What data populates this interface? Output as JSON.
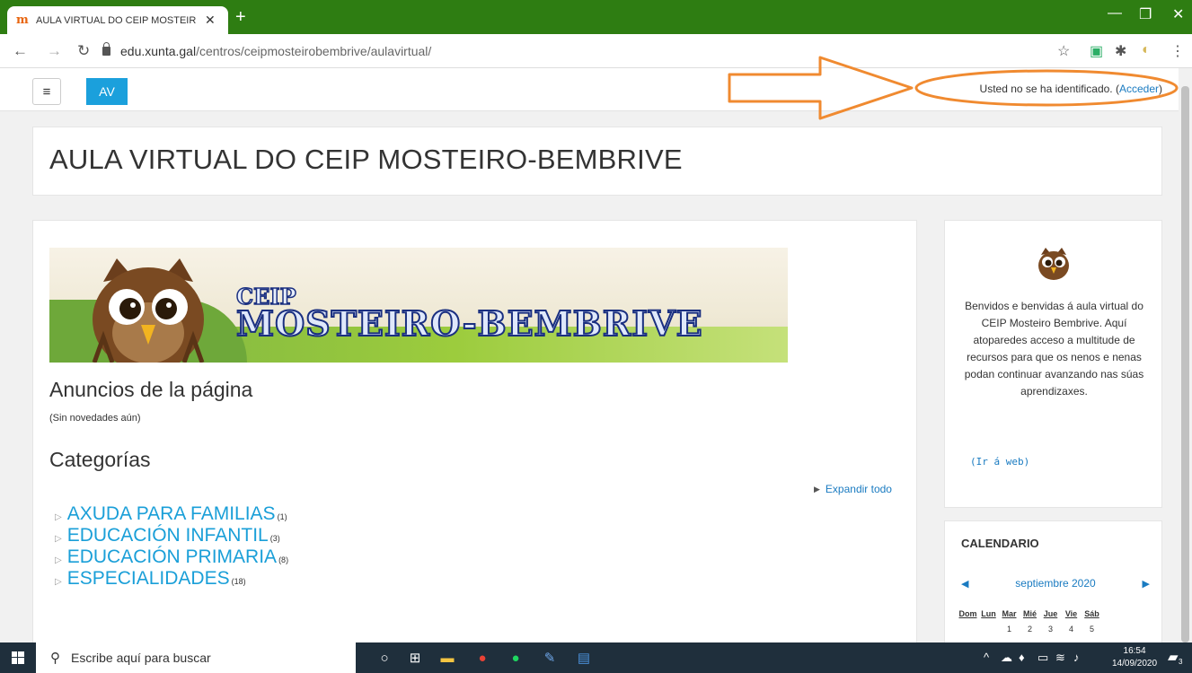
{
  "browser": {
    "tab_title": "AULA VIRTUAL DO CEIP MOSTEIR",
    "url_host": "edu.xunta.gal",
    "url_path": "/centros/ceipmosteirobembrive/aulavirtual/"
  },
  "navbar": {
    "brand": "AV",
    "login_text": "Usted no se ha identificado. (",
    "login_link": "Acceder",
    "login_close": ")"
  },
  "page": {
    "title": "AULA VIRTUAL DO CEIP MOSTEIRO-BEMBRIVE",
    "banner_line1": "CEIP",
    "banner_line2": "MOSTEIRO-BEMBRIVE",
    "anuncios_heading": "Anuncios de la página",
    "sin_novedades": "(Sin novedades aún)",
    "categorias_heading": "Categorías",
    "expandir": "Expandir todo",
    "categories": [
      {
        "name": "AXUDA PARA FAMILIAS",
        "count": "(1)"
      },
      {
        "name": "EDUCACIÓN INFANTIL",
        "count": "(3)"
      },
      {
        "name": "EDUCACIÓN PRIMARIA",
        "count": "(8)"
      },
      {
        "name": "ESPECIALIDADES",
        "count": "(18)"
      }
    ]
  },
  "sidebar": {
    "intro": "Benvidos e benvidas á aula virtual do CEIP Mosteiro Bembrive. Aquí atoparedes acceso a multitude de recursos para que os nenos e nenas podan continuar avanzando nas súas aprendizaxes.",
    "ir_web": "(Ir á web)",
    "calendar": {
      "title": "CALENDARIO",
      "month": "septiembre 2020",
      "days": [
        "Dom",
        "Lun",
        "Mar",
        "Mié",
        "Jue",
        "Vie",
        "Sáb"
      ],
      "first_row": [
        "",
        "",
        "1",
        "2",
        "3",
        "4",
        "5"
      ]
    }
  },
  "taskbar": {
    "search_placeholder": "Escribe aquí para buscar",
    "time": "16:54",
    "date": "14/09/2020",
    "notifications": "3"
  },
  "colors": {
    "browser_frame": "#2e7d12",
    "link": "#1a7bc1",
    "category": "#1a9fd8",
    "brand": "#1ba0dc",
    "annotation": "#f08a30"
  }
}
